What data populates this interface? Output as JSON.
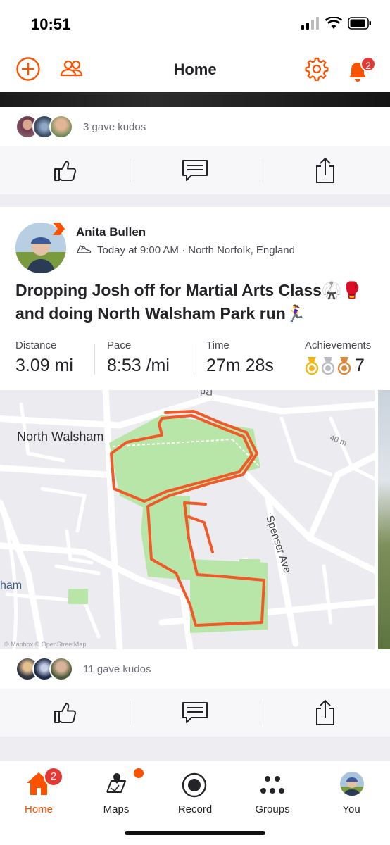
{
  "status_bar": {
    "time": "10:51"
  },
  "header": {
    "title": "Home",
    "notification_count": "2"
  },
  "previous_post": {
    "kudos_text": "3 gave kudos"
  },
  "activity": {
    "athlete_name": "Anita Bullen",
    "meta": "Today at 9:00 AM · North Norfolk, England",
    "title": "Dropping Josh off for Martial Arts Class🥋🥊 and doing North Walsham Park run🏃‍♀️",
    "stats": [
      {
        "label": "Distance",
        "value": "3.09 mi"
      },
      {
        "label": "Pace",
        "value": "8:53 /mi"
      },
      {
        "label": "Time",
        "value": "27m 28s"
      }
    ],
    "achievements": {
      "label": "Achievements",
      "count": "7"
    },
    "map": {
      "town_label": "North Walsham",
      "street_label": "Spenser Ave",
      "edge_label": "ham",
      "road_top_label": "Rd",
      "small_label": "40 m",
      "attribution": "© Mapbox © OpenStreetMap"
    },
    "kudos_text": "11 gave kudos"
  },
  "tabs": [
    {
      "label": "Home",
      "badge": "2"
    },
    {
      "label": "Maps"
    },
    {
      "label": "Record"
    },
    {
      "label": "Groups"
    },
    {
      "label": "You"
    }
  ],
  "colors": {
    "brand": "#fc5200",
    "badge": "#e53935",
    "route": "#f05a28",
    "park": "#b8e6a8"
  }
}
